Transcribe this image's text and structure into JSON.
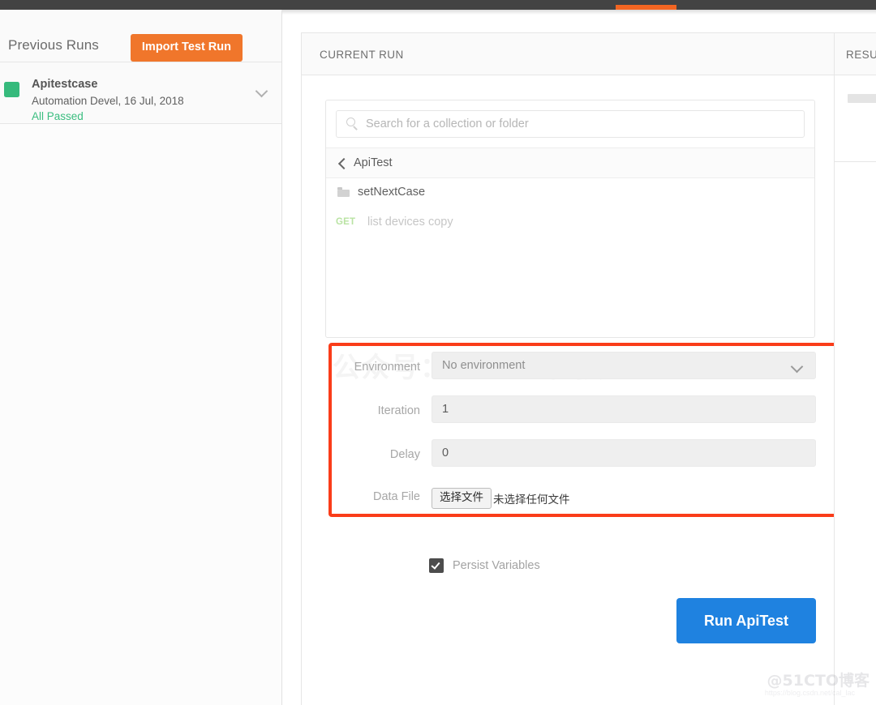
{
  "window": {
    "accent_orange": "#f26522",
    "tab_indicator": "active-tab"
  },
  "sidebar": {
    "title": "Previous Runs",
    "import_button": "Import Test Run",
    "runs": [
      {
        "name": "Apitestcase",
        "meta": "Automation Devel, 16 Jul, 2018",
        "status": "All Passed",
        "status_color": "#3abd7f",
        "square_color": "#36ba7c",
        "expand_icon": "chevron-down-icon"
      }
    ]
  },
  "current_run": {
    "header": "CURRENT RUN",
    "search": {
      "placeholder": "Search for a collection or folder",
      "value": "",
      "icon": "search-icon"
    },
    "breadcrumb": {
      "label": "ApiTest",
      "back_icon": "chevron-left-icon"
    },
    "items": [
      {
        "type": "folder",
        "icon": "folder-icon",
        "label": "setNextCase",
        "method": ""
      },
      {
        "type": "request",
        "icon": "",
        "label": "list devices copy",
        "method": "GET",
        "method_color": "#b9e3a3"
      }
    ],
    "form": {
      "environment": {
        "label": "Environment",
        "value": "No environment",
        "icon": "chevron-down-icon"
      },
      "iteration": {
        "label": "Iteration",
        "value": "1"
      },
      "delay": {
        "label": "Delay",
        "value": "0"
      },
      "data_file": {
        "label": "Data File",
        "button": "选择文件",
        "status": "未选择任何文件"
      }
    },
    "persist_variables": {
      "label": "Persist Variables",
      "checked": true
    },
    "run_button": {
      "label": "Run ApiTest",
      "color": "#1f82e0"
    },
    "highlight": {
      "color": "#fa3c19",
      "note": "red-annotation-box"
    }
  },
  "results_panel": {
    "header": "RESULTS"
  },
  "watermarks": {
    "form_overlay": "公众号：Java编程技",
    "bottom_right": "@51CTO博客",
    "bottom_right_sub": "https://blog.csdn.net/cal_lac"
  }
}
